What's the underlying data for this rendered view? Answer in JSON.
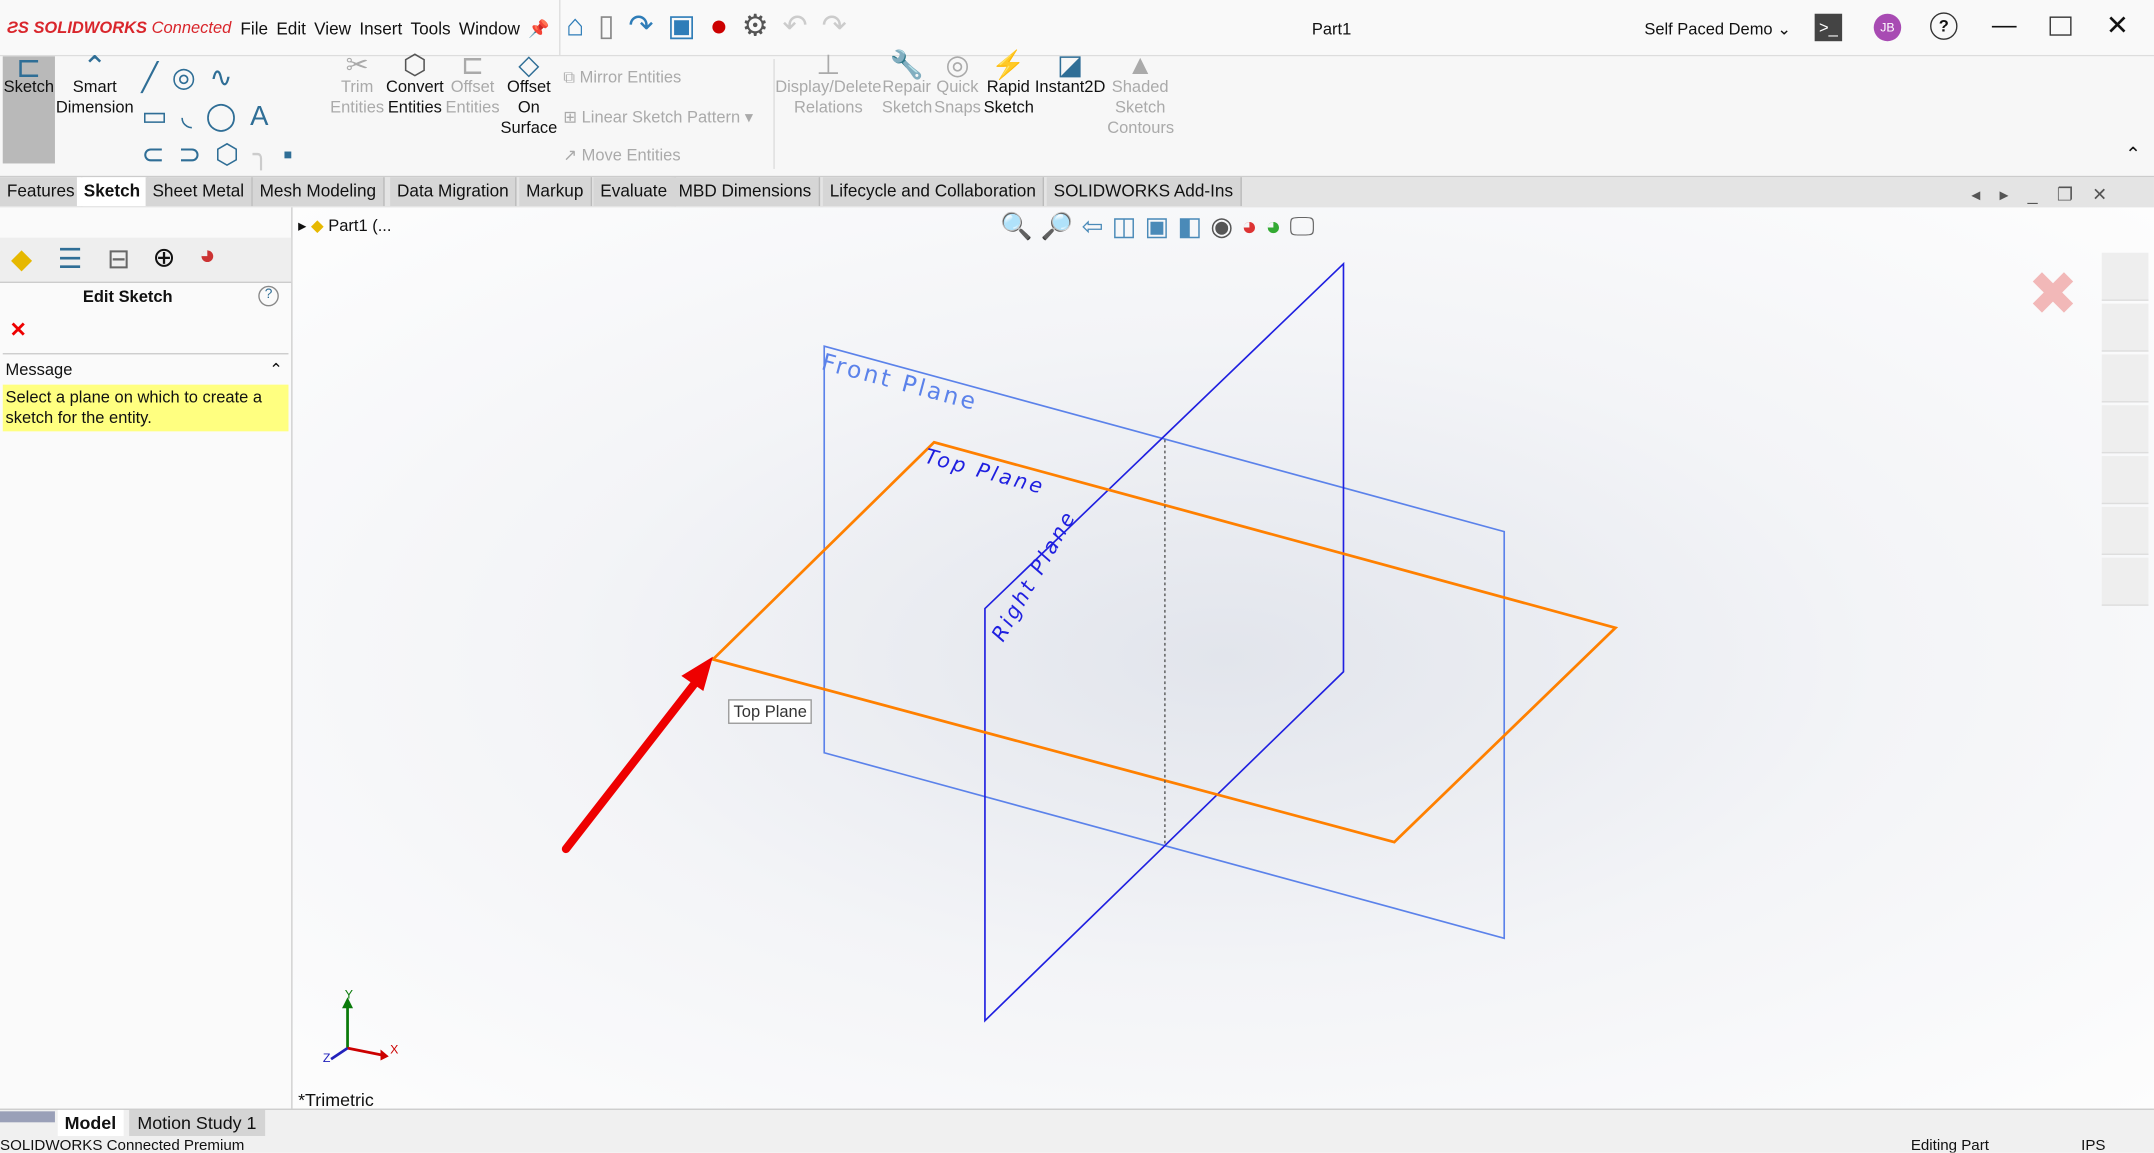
{
  "app": {
    "brand": "SOLIDWORKS Connected",
    "title": "Part1",
    "workspace": "Self Paced Demo",
    "avatar": "JB",
    "brand_color": "#d9262c"
  },
  "menu": [
    "File",
    "Edit",
    "View",
    "Insert",
    "Tools",
    "Window"
  ],
  "ribbon": {
    "sketch": "Sketch",
    "smart_dimension": [
      "Smart",
      "Dimension"
    ],
    "trim": [
      "Trim",
      "Entities"
    ],
    "convert": [
      "Convert",
      "Entities"
    ],
    "offset": [
      "Offset",
      "Entities"
    ],
    "offset_surface": [
      "Offset",
      "On",
      "Surface"
    ],
    "mirror": "Mirror Entities",
    "linear_pattern": "Linear Sketch Pattern",
    "move": "Move Entities",
    "display_delete": [
      "Display/Delete",
      "Relations"
    ],
    "repair": [
      "Repair",
      "Sketch"
    ],
    "quick_snaps": [
      "Quick",
      "Snaps"
    ],
    "rapid": [
      "Rapid",
      "Sketch"
    ],
    "instant2d": "Instant2D",
    "shaded": [
      "Shaded",
      "Sketch",
      "Contours"
    ]
  },
  "tabs": [
    "Features",
    "Sketch",
    "Sheet Metal",
    "Mesh Modeling",
    "Data Migration",
    "Markup",
    "Evaluate",
    "MBD Dimensions",
    "Lifecycle and Collaboration",
    "SOLIDWORKS Add-Ins"
  ],
  "active_tab": "Sketch",
  "property_manager": {
    "title": "Edit Sketch",
    "section": "Message",
    "message": "Select a plane on which to create a sketch for the entity."
  },
  "tree": {
    "root": "Part1 (..."
  },
  "viewport": {
    "planes": {
      "front": "Front Plane",
      "top": "Top Plane",
      "right": "Right Plane"
    },
    "tooltip": "Top Plane",
    "view_name": "*Trimetric",
    "axes": {
      "x": "X",
      "y": "Y",
      "z": "Z"
    },
    "colors": {
      "front": "#5b82ea",
      "right": "#1f1fe0",
      "top": "#ff8000",
      "arrow": "#ee0000"
    }
  },
  "bottom_tabs": [
    "Model",
    "Motion Study 1"
  ],
  "status": {
    "left": "SOLIDWORKS Connected Premium",
    "mode": "Editing Part",
    "units": "IPS"
  }
}
